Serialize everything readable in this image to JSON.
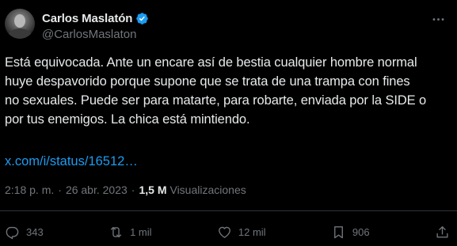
{
  "author": {
    "display_name": "Carlos Maslatón",
    "handle": "@CarlosMaslaton",
    "verified": true,
    "verified_color": "#1d9bf0"
  },
  "tweet": {
    "text": "Está equivocada. Ante un encare así de bestia cualquier hombre normal\nhuye despavorido porque supone que se trata de una trampa con fines\nno sexuales. Puede ser para matarte, para robarte, enviada por la SIDE o\npor tus enemigos. La chica está mintiendo.",
    "link": "x.com/i/status/16512…",
    "link_color": "#1d9bf0"
  },
  "meta": {
    "time": "2:18 p. m.",
    "separator": "·",
    "date": "26 abr. 2023",
    "views_count": "1,5 M",
    "views_label": "Visualizaciones"
  },
  "actions": {
    "replies": "343",
    "reposts": "1 mil",
    "likes": "12 mil",
    "bookmarks": "906"
  },
  "icons": {
    "more": "more-horizontal-icon",
    "reply": "reply-icon",
    "repost": "repost-icon",
    "like": "heart-icon",
    "bookmark": "bookmark-icon",
    "share": "share-icon"
  },
  "colors": {
    "background": "#000000",
    "text_primary": "#e7e9ea",
    "text_secondary": "#71767b",
    "divider": "#2f3336"
  }
}
